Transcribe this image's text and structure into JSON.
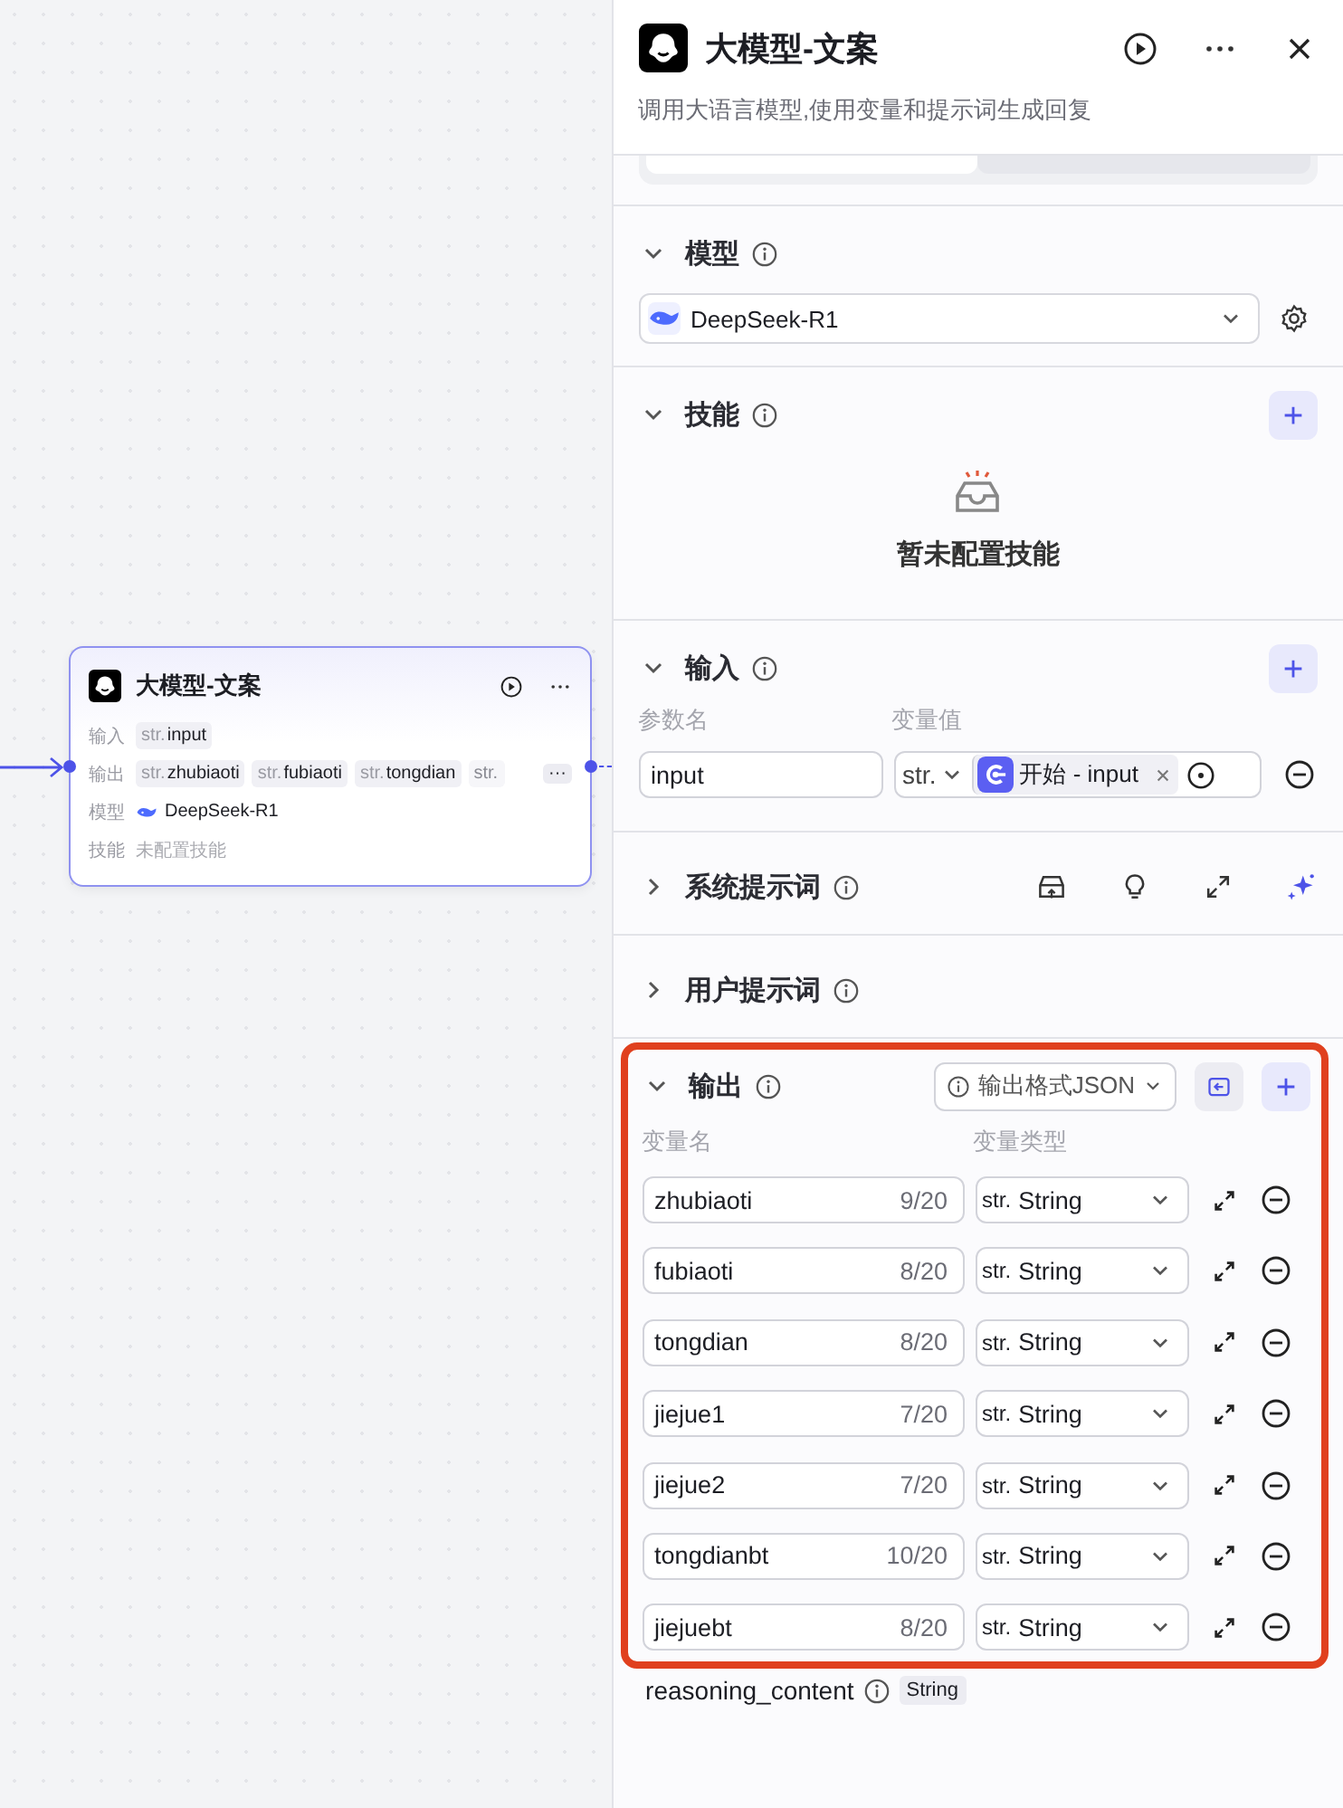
{
  "canvas": {
    "node": {
      "title": "大模型-文案",
      "rows": [
        {
          "label": "输入",
          "kind": "tags",
          "tags": [
            {
              "prefix": "str.",
              "name": "input"
            }
          ]
        },
        {
          "label": "输出",
          "kind": "tags",
          "more": "···",
          "tags": [
            {
              "prefix": "str.",
              "name": "zhubiaoti"
            },
            {
              "prefix": "str.",
              "name": "fubiaoti"
            },
            {
              "prefix": "str.",
              "name": "tongdian"
            },
            {
              "prefix": "str.",
              "faded": true
            }
          ]
        },
        {
          "label": "模型",
          "kind": "model",
          "value": "DeepSeek-R1"
        },
        {
          "label": "技能",
          "kind": "muted",
          "value": "未配置技能"
        }
      ]
    }
  },
  "panel": {
    "title": "大模型-文案",
    "description": "调用大语言模型,使用变量和提示词生成回复",
    "mode_switch": [
      {
        "selected": true
      },
      {
        "selected": false
      }
    ],
    "sections": [
      {
        "kind": "model",
        "title": "模型",
        "expanded": true,
        "model": "DeepSeek-R1"
      },
      {
        "kind": "skills",
        "title": "技能",
        "expanded": true,
        "empty_text": "暂未配置技能"
      },
      {
        "kind": "inputs",
        "title": "输入",
        "expanded": true,
        "columns": [
          "参数名",
          "变量值"
        ],
        "rows": [
          {
            "name": "input",
            "type": "str.",
            "ref": "开始 - input"
          }
        ]
      },
      {
        "kind": "prompt",
        "title": "系统提示词",
        "expanded": false
      },
      {
        "kind": "plain",
        "title": "用户提示词",
        "expanded": false
      },
      {
        "kind": "outputs",
        "title": "输出",
        "expanded": true,
        "highlighted": true,
        "format": "输出格式JSON",
        "columns": [
          "变量名",
          "变量类型"
        ],
        "rows": [
          {
            "name": "zhubiaoti",
            "count": "9/20",
            "prefix": "str.",
            "type": "String"
          },
          {
            "name": "fubiaoti",
            "count": "8/20",
            "prefix": "str.",
            "type": "String"
          },
          {
            "name": "tongdian",
            "count": "8/20",
            "prefix": "str.",
            "type": "String"
          },
          {
            "name": "jiejue1",
            "count": "7/20",
            "prefix": "str.",
            "type": "String"
          },
          {
            "name": "jiejue2",
            "count": "7/20",
            "prefix": "str.",
            "type": "String"
          },
          {
            "name": "tongdianbt",
            "count": "10/20",
            "prefix": "str.",
            "type": "String"
          },
          {
            "name": "jiejuebt",
            "count": "8/20",
            "prefix": "str.",
            "type": "String"
          }
        ],
        "extra": {
          "name": "reasoning_content",
          "type": "String"
        }
      }
    ]
  }
}
